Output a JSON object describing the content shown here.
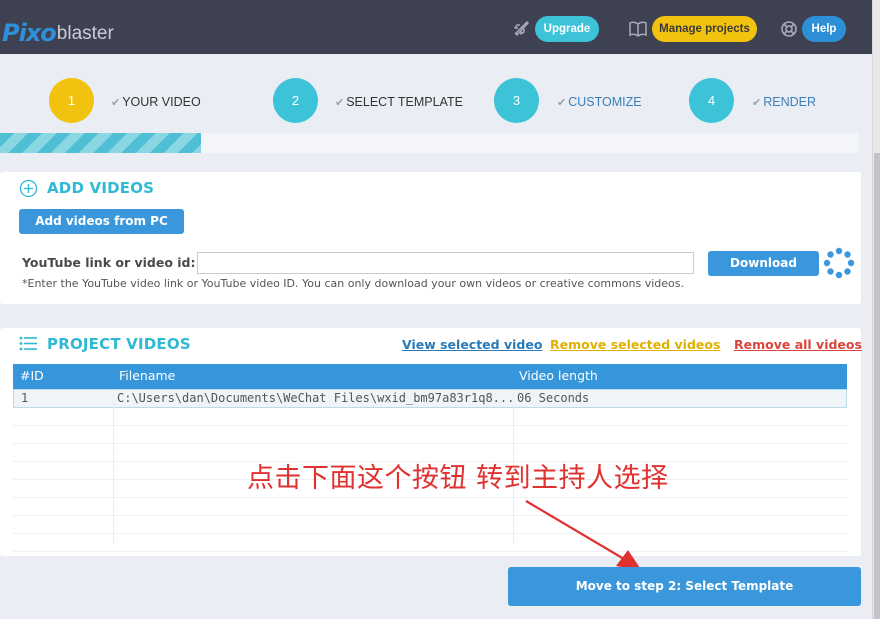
{
  "header": {
    "logo_mark": "Pixo",
    "logo_text": "blaster",
    "upgrade_label": "Upgrade",
    "manage_label": "Manage projects",
    "help_label": "Help"
  },
  "steps": [
    {
      "number": "1",
      "label": "YOUR VIDEO",
      "circle_color": "#f2c30e",
      "label_color": "#333333"
    },
    {
      "number": "2",
      "label": "SELECT TEMPLATE",
      "circle_color": "#3cc3d8",
      "label_color": "#333333"
    },
    {
      "number": "3",
      "label": "CUSTOMIZE",
      "circle_color": "#3cc3d8",
      "label_color": "#3a7fb8"
    },
    {
      "number": "4",
      "label": "RENDER",
      "circle_color": "#3cc3d8",
      "label_color": "#3a7fb8"
    }
  ],
  "progress": {
    "fraction": 0.234
  },
  "add_videos": {
    "title": "ADD VIDEOS",
    "add_pc_label": "Add videos from PC",
    "youtube_label": "YouTube link or video id:",
    "youtube_value": "",
    "download_label": "Download",
    "hint": "*Enter the YouTube video link or YouTube video ID. You can only download your own videos or creative commons videos."
  },
  "project_videos": {
    "title": "PROJECT VIDEOS",
    "view_selected": "View selected video",
    "remove_selected": "Remove selected videos",
    "remove_all": "Remove all videos",
    "columns": [
      "#ID",
      "Filename",
      "Video length"
    ],
    "rows": [
      {
        "id": "1",
        "filename": "C:\\Users\\dan\\Documents\\WeChat Files\\wxid_bm97a83r1q8...",
        "length": "06 Seconds"
      }
    ]
  },
  "annotation": "点击下面这个按钮 转到主持人选择",
  "next_button_label": "Move to step 2: Select Template",
  "colors": {
    "accent_cyan": "#2fb9d2",
    "accent_blue": "#3b97dc",
    "link_blue": "#2a7ab8",
    "link_yellow": "#e0b000",
    "link_red": "#d9453d",
    "annotation_red": "#e03131"
  },
  "icons": {
    "upgrade": "rocket-icon",
    "manage": "book-icon",
    "help": "lifebuoy-icon",
    "add_videos": "plus-circle-icon",
    "project_videos": "list-icon",
    "step_check": "check-icon",
    "loader": "spinner-icon"
  }
}
